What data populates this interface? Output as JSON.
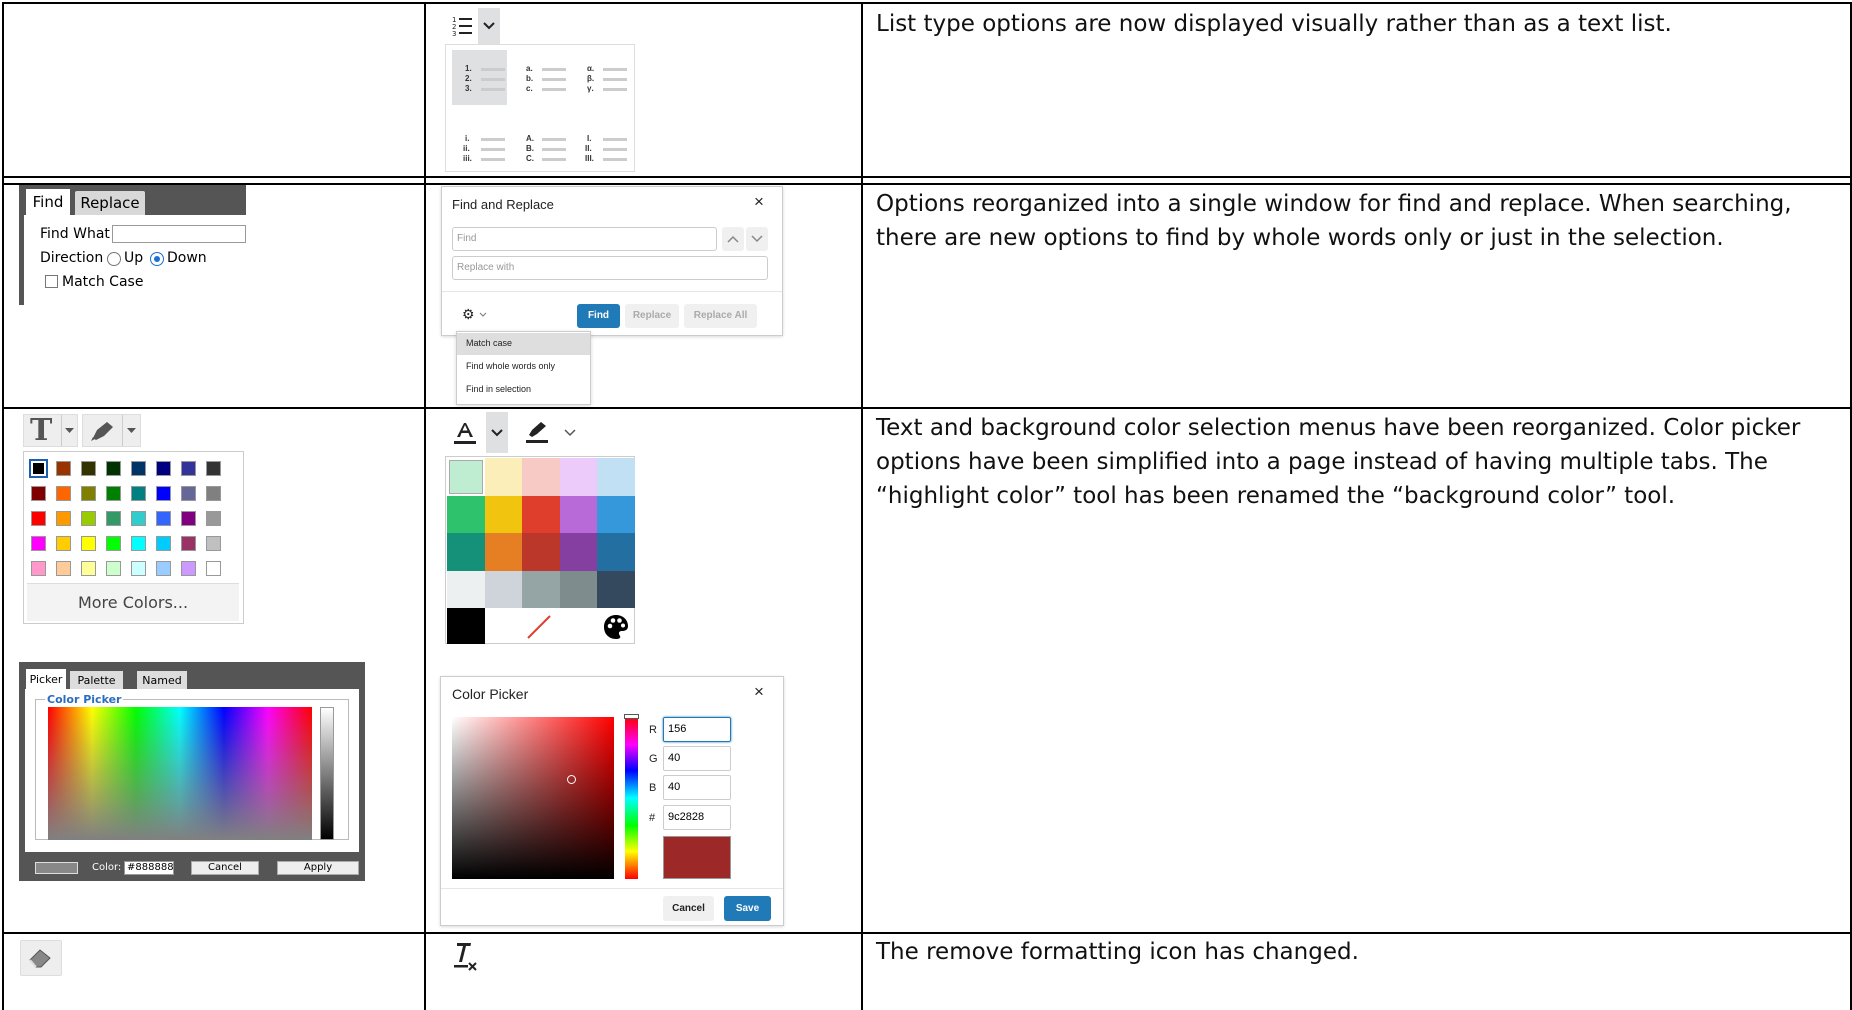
{
  "rows": [
    {
      "description": "List type options are now displayed visually rather than as a text list."
    },
    {
      "description": "Options reorganized into a single window for find and replace. When searching, there are new options to find by whole words only or just in the selection."
    },
    {
      "description": "Text and background color selection menus have been reorganized. Color picker options have been simplified into a page instead of having multiple tabs. The “highlight color” tool has been renamed the “background color” tool."
    },
    {
      "description": "The remove formatting icon has changed."
    }
  ],
  "list_menu": {
    "items": [
      [
        "1.",
        "2.",
        "3."
      ],
      [
        "a.",
        "b.",
        "c."
      ],
      [
        "α.",
        "β.",
        "γ."
      ],
      [
        "i.",
        "ii.",
        "iii."
      ],
      [
        "A.",
        "B.",
        "C."
      ],
      [
        "I.",
        "II.",
        "III."
      ]
    ]
  },
  "old_find": {
    "tab_find": "Find",
    "tab_replace": "Replace",
    "find_what": "Find What",
    "direction": "Direction",
    "up": "Up",
    "down": "Down",
    "match_case": "Match Case"
  },
  "new_find": {
    "title": "Find and Replace",
    "find_placeholder": "Find",
    "replace_placeholder": "Replace with",
    "find_btn": "Find",
    "replace_btn": "Replace",
    "replace_all_btn": "Replace All",
    "menu": [
      "Match case",
      "Find whole words only",
      "Find in selection"
    ]
  },
  "old_colors": {
    "grid": [
      [
        "#000000",
        "#993300",
        "#333300",
        "#003300",
        "#003366",
        "#000080",
        "#333399",
        "#333333"
      ],
      [
        "#800000",
        "#ff6600",
        "#808000",
        "#008000",
        "#008080",
        "#0000ff",
        "#666699",
        "#808080"
      ],
      [
        "#ff0000",
        "#ff9900",
        "#99cc00",
        "#339966",
        "#33cccc",
        "#3366ff",
        "#800080",
        "#999999"
      ],
      [
        "#ff00ff",
        "#ffcc00",
        "#ffff00",
        "#00ff00",
        "#00ffff",
        "#00ccff",
        "#993366",
        "#c0c0c0"
      ],
      [
        "#ff99cc",
        "#ffcc99",
        "#ffff99",
        "#ccffcc",
        "#ccffff",
        "#99ccff",
        "#cc99ff",
        "#ffffff"
      ]
    ],
    "more_colors": "More Colors..."
  },
  "old_picker": {
    "tabs": [
      "Picker",
      "Palette",
      "Named"
    ],
    "group_label": "Color Picker",
    "color_label": "Color:",
    "color_value": "#888888",
    "cancel": "Cancel",
    "apply": "Apply"
  },
  "new_colors": {
    "grid": [
      [
        "#bfedd2",
        "#fbeeb8",
        "#f8cac6",
        "#eccafa",
        "#c2e0f4"
      ],
      [
        "#2dc26b",
        "#f1c40f",
        "#e03e2d",
        "#b96ad9",
        "#3598db"
      ],
      [
        "#169179",
        "#e67e23",
        "#ba372a",
        "#843fa1",
        "#236fa1"
      ],
      [
        "#ecf0f1",
        "#ced4d9",
        "#95a5a6",
        "#7e8c8d",
        "#34495e"
      ]
    ]
  },
  "new_picker": {
    "title": "Color Picker",
    "r_label": "R",
    "r": "156",
    "g_label": "G",
    "g": "40",
    "b_label": "B",
    "b": "40",
    "hex_label": "#",
    "hex": "9c2828",
    "preview_color": "#9c2828",
    "cancel": "Cancel",
    "save": "Save"
  }
}
